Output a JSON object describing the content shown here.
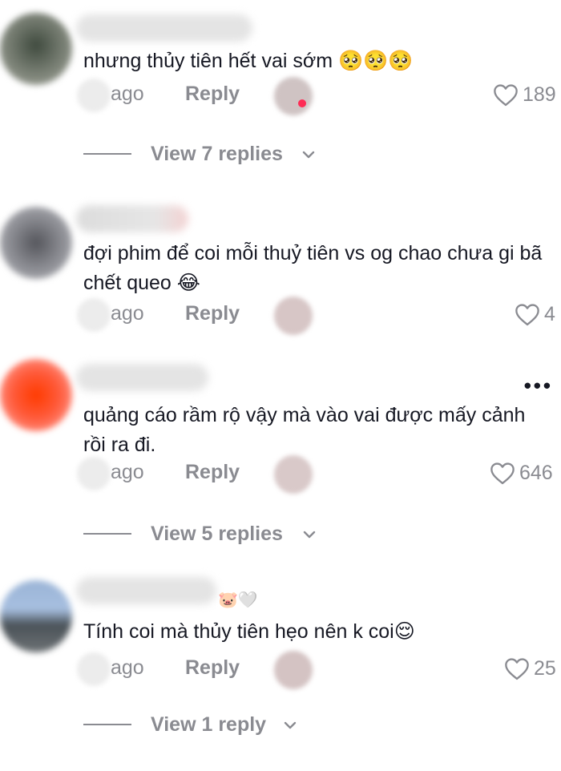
{
  "comments": [
    {
      "text": "nhưng thủy tiên hết vai sớm 🥺🥺🥺",
      "ago": "ago",
      "reply": "Reply",
      "likes": "189",
      "view_replies": "View 7 replies"
    },
    {
      "text": "đợi phim để coi mỗi thuỷ tiên vs og chao chưa gi bã chết queo 😂",
      "ago": "ago",
      "reply": "Reply",
      "likes": "4"
    },
    {
      "text": "quảng cáo rầm rộ vậy mà vào vai được mấy cảnh rồi ra đi.",
      "ago": "ago",
      "reply": "Reply",
      "likes": "646",
      "more": "•••",
      "view_replies": "View 5 replies"
    },
    {
      "name_emoji": "🐷🤍",
      "text": "Tính coi mà thủy tiên hẹo nên k coi😌",
      "ago": "ago",
      "reply": "Reply",
      "likes": "25",
      "view_replies": "View 1 reply"
    }
  ],
  "icons": {
    "heart": "heart-outline-icon",
    "chevron": "chevron-down-icon",
    "more": "more-options-icon"
  },
  "colors": {
    "text": "#161823",
    "muted": "#8a8b91",
    "accent": "#fe2c55"
  }
}
